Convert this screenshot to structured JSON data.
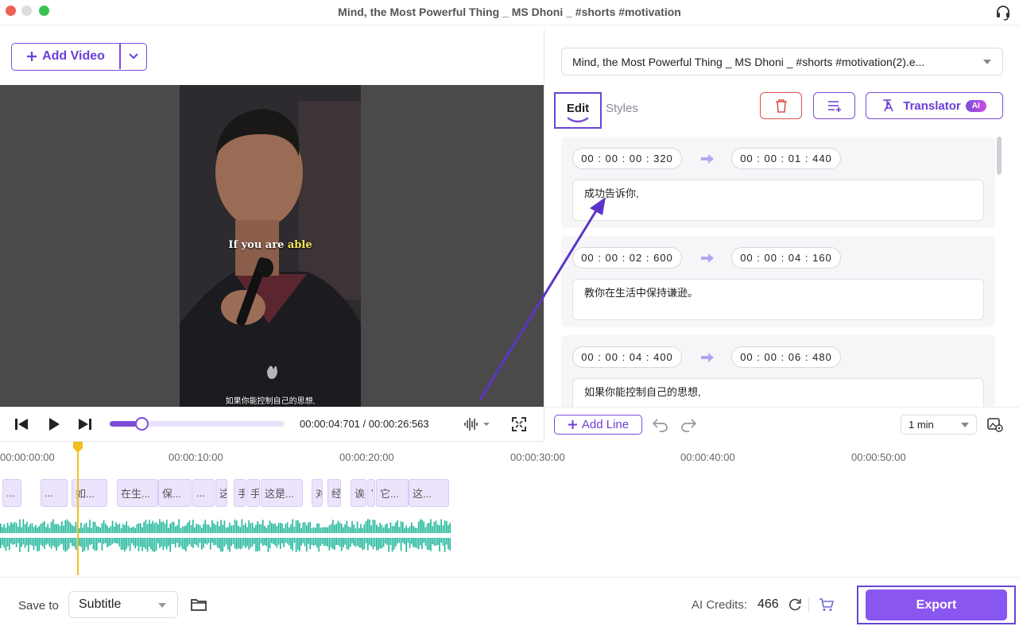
{
  "window": {
    "title": "Mind, the Most Powerful Thing _ MS Dhoni _ #shorts #motivation"
  },
  "toolbar": {
    "add_video_label": "Add Video"
  },
  "preview": {
    "caption_en_prefix": "If you are ",
    "caption_en_highlight": "able",
    "caption_zh": "如果你能控制自己的思想,"
  },
  "playback": {
    "time_display": "00:00:04:701 / 00:00:26:563",
    "progress_fraction": 0.18
  },
  "right_panel": {
    "file_name": "Mind, the Most Powerful Thing _ MS Dhoni _ #shorts #motivation(2).e...",
    "tabs": [
      {
        "label": "Edit"
      },
      {
        "label": "Styles"
      }
    ],
    "translator_label": "Translator",
    "ai_badge": "AI",
    "subtitles": [
      {
        "start": "00 : 00 : 00 : 320",
        "end": "00 : 00 : 01 : 440",
        "text": "成功告诉你,"
      },
      {
        "start": "00 : 00 : 02 : 600",
        "end": "00 : 00 : 04 : 160",
        "text": "教你在生活中保持谦逊。"
      },
      {
        "start": "00 : 00 : 04 : 400",
        "end": "00 : 00 : 06 : 480",
        "text": "如果你能控制自己的思想,"
      }
    ],
    "add_line_label": "Add Line",
    "duration_value": "1 min"
  },
  "timeline": {
    "ticks": [
      "00:00:00:00",
      "00:00:10:00",
      "00:00:20:00",
      "00:00:30:00",
      "00:00:40:00",
      "00:00:50:00"
    ],
    "segments": [
      "...",
      "...",
      "如...",
      "在生...",
      "保...",
      "...",
      "这",
      "手",
      "手",
      "这是...",
      "对",
      "经",
      "诶",
      "'",
      "它...",
      "这..."
    ]
  },
  "bottom": {
    "save_to_label": "Save to",
    "save_to_value": "Subtitle",
    "credits_label": "AI Credits:",
    "credits_value": "466",
    "export_label": "Export"
  },
  "colors": {
    "accent": "#7b4ddb",
    "export": "#8a56f0",
    "wave": "#1fb79a",
    "playhead": "#f0c020",
    "danger": "#d9534f"
  }
}
